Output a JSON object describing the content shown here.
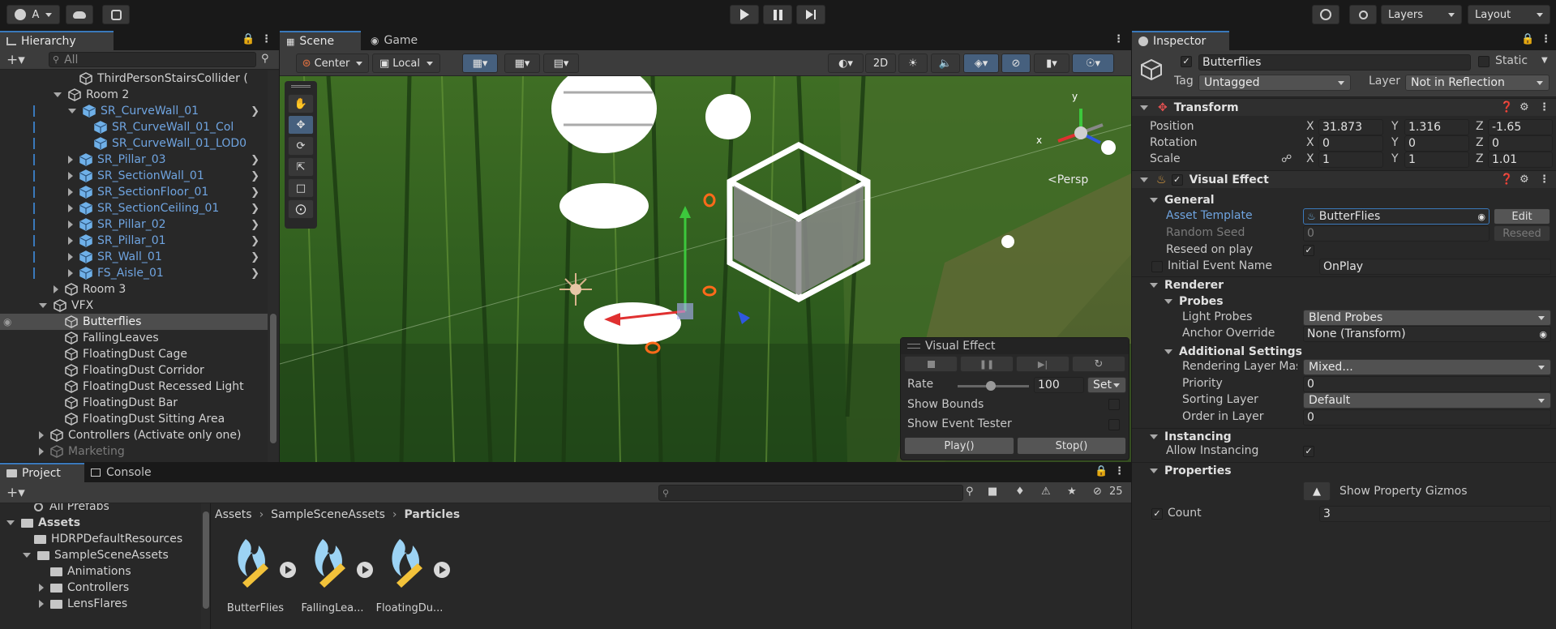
{
  "toolbar": {
    "account_label": "A",
    "layers_label": "Layers",
    "layout_label": "Layout"
  },
  "hierarchy": {
    "tab_label": "Hierarchy",
    "search_placeholder": "All",
    "items": [
      {
        "label": "ThirdPersonStairsCollider (",
        "indent": 3,
        "arrow": "none",
        "prefab": false,
        "chevron": false
      },
      {
        "label": "Room 2",
        "indent": 2,
        "arrow": "down",
        "prefab": false,
        "chevron": false
      },
      {
        "label": "SR_CurveWall_01",
        "indent": 3,
        "arrow": "down",
        "prefab": true,
        "chevron": true
      },
      {
        "label": "SR_CurveWall_01_Col",
        "indent": 4,
        "arrow": "none",
        "prefab": true,
        "chevron": false
      },
      {
        "label": "SR_CurveWall_01_LOD0",
        "indent": 4,
        "arrow": "none",
        "prefab": true,
        "chevron": false
      },
      {
        "label": "SR_Pillar_03",
        "indent": 3,
        "arrow": "right",
        "prefab": true,
        "chevron": true
      },
      {
        "label": "SR_SectionWall_01",
        "indent": 3,
        "arrow": "right",
        "prefab": true,
        "chevron": true
      },
      {
        "label": "SR_SectionFloor_01",
        "indent": 3,
        "arrow": "right",
        "prefab": true,
        "chevron": true
      },
      {
        "label": "SR_SectionCeiling_01",
        "indent": 3,
        "arrow": "right",
        "prefab": true,
        "chevron": true
      },
      {
        "label": "SR_Pillar_02",
        "indent": 3,
        "arrow": "right",
        "prefab": true,
        "chevron": true
      },
      {
        "label": "SR_Pillar_01",
        "indent": 3,
        "arrow": "right",
        "prefab": true,
        "chevron": true
      },
      {
        "label": "SR_Wall_01",
        "indent": 3,
        "arrow": "right",
        "prefab": true,
        "chevron": true
      },
      {
        "label": "FS_Aisle_01",
        "indent": 3,
        "arrow": "right",
        "prefab": true,
        "chevron": true
      },
      {
        "label": "Room 3",
        "indent": 2,
        "arrow": "right",
        "prefab": false,
        "chevron": false
      },
      {
        "label": "VFX",
        "indent": 1,
        "arrow": "down",
        "prefab": false,
        "chevron": false
      },
      {
        "label": "Butterflies",
        "indent": 2,
        "arrow": "none",
        "prefab": false,
        "chevron": false,
        "selected": true
      },
      {
        "label": "FallingLeaves",
        "indent": 2,
        "arrow": "none",
        "prefab": false,
        "chevron": false
      },
      {
        "label": "FloatingDust Cage",
        "indent": 2,
        "arrow": "none",
        "prefab": false,
        "chevron": false
      },
      {
        "label": "FloatingDust Corridor",
        "indent": 2,
        "arrow": "none",
        "prefab": false,
        "chevron": false
      },
      {
        "label": "FloatingDust Recessed Light",
        "indent": 2,
        "arrow": "none",
        "prefab": false,
        "chevron": false
      },
      {
        "label": "FloatingDust Bar",
        "indent": 2,
        "arrow": "none",
        "prefab": false,
        "chevron": false
      },
      {
        "label": "FloatingDust Sitting Area",
        "indent": 2,
        "arrow": "none",
        "prefab": false,
        "chevron": false
      },
      {
        "label": "Controllers (Activate only one)",
        "indent": 1,
        "arrow": "right",
        "prefab": false,
        "chevron": false
      },
      {
        "label": "Marketing",
        "indent": 1,
        "arrow": "right",
        "prefab": false,
        "chevron": false,
        "dim": true
      }
    ]
  },
  "scene": {
    "tabs": [
      {
        "label": "Scene"
      },
      {
        "label": "Game"
      }
    ],
    "pivot_mode": "Center",
    "pivot_space": "Local",
    "toggle_2d": "2D",
    "persp_label": "<Persp",
    "gizmo_axes": {
      "x": "x",
      "y": "y"
    },
    "overlay": {
      "title": "Visual Effect",
      "rate_label": "Rate",
      "rate_value": "100",
      "set_label": "Set",
      "show_bounds_label": "Show Bounds",
      "show_event_tester_label": "Show Event Tester",
      "play_label": "Play()",
      "stop_label": "Stop()"
    }
  },
  "project": {
    "tabs": [
      {
        "label": "Project"
      },
      {
        "label": "Console"
      }
    ],
    "badge_count": "25",
    "tree": [
      {
        "label": "All Prefabs",
        "indent": 1,
        "type": "search"
      },
      {
        "label": "Assets",
        "indent": 0,
        "type": "folder-open",
        "bold": true
      },
      {
        "label": "HDRPDefaultResources",
        "indent": 1,
        "type": "folder"
      },
      {
        "label": "SampleSceneAssets",
        "indent": 1,
        "type": "folder-open"
      },
      {
        "label": "Animations",
        "indent": 2,
        "type": "folder"
      },
      {
        "label": "Controllers",
        "indent": 2,
        "type": "folder-arrow"
      },
      {
        "label": "LensFlares",
        "indent": 2,
        "type": "folder-arrow"
      }
    ],
    "breadcrumb": [
      "Assets",
      "SampleSceneAssets",
      "Particles"
    ],
    "assets": [
      {
        "label": "ButterFlies"
      },
      {
        "label": "FallingLea..."
      },
      {
        "label": "FloatingDu..."
      }
    ]
  },
  "inspector": {
    "tab_label": "Inspector",
    "object_name": "Butterflies",
    "static_label": "Static",
    "tag_label": "Tag",
    "tag_value": "Untagged",
    "layer_label": "Layer",
    "layer_value": "Not in Reflection",
    "transform": {
      "title": "Transform",
      "position_label": "Position",
      "rotation_label": "Rotation",
      "scale_label": "Scale",
      "position": {
        "x": "31.873",
        "y": "1.316",
        "z": "-1.65"
      },
      "rotation": {
        "x": "0",
        "y": "0",
        "z": "0"
      },
      "scale": {
        "x": "1",
        "y": "1",
        "z": "1.01"
      },
      "axis_x": "X",
      "axis_y": "Y",
      "axis_z": "Z"
    },
    "visual_effect": {
      "title": "Visual Effect",
      "general_label": "General",
      "asset_template_label": "Asset Template",
      "asset_template_value": "ButterFlies",
      "edit_label": "Edit",
      "random_seed_label": "Random Seed",
      "random_seed_value": "0",
      "reseed_label": "Reseed",
      "reseed_on_play_label": "Reseed on play",
      "initial_event_label": "Initial Event Name",
      "initial_event_value": "OnPlay",
      "renderer_label": "Renderer",
      "probes_label": "Probes",
      "light_probes_label": "Light Probes",
      "light_probes_value": "Blend Probes",
      "anchor_override_label": "Anchor Override",
      "anchor_override_value": "None (Transform)",
      "additional_settings_label": "Additional Settings",
      "rendering_layer_label": "Rendering Layer Mas",
      "rendering_layer_value": "Mixed...",
      "priority_label": "Priority",
      "priority_value": "0",
      "sorting_layer_label": "Sorting Layer",
      "sorting_layer_value": "Default",
      "order_in_layer_label": "Order in Layer",
      "order_in_layer_value": "0",
      "instancing_label": "Instancing",
      "allow_instancing_label": "Allow Instancing",
      "properties_label": "Properties",
      "show_gizmos_label": "Show Property Gizmos",
      "count_label": "Count",
      "count_value": "3"
    }
  },
  "colors": {
    "accent": "#3a79bb",
    "prefab_blue": "#6fa4e0",
    "selection": "#4d4d4d"
  }
}
